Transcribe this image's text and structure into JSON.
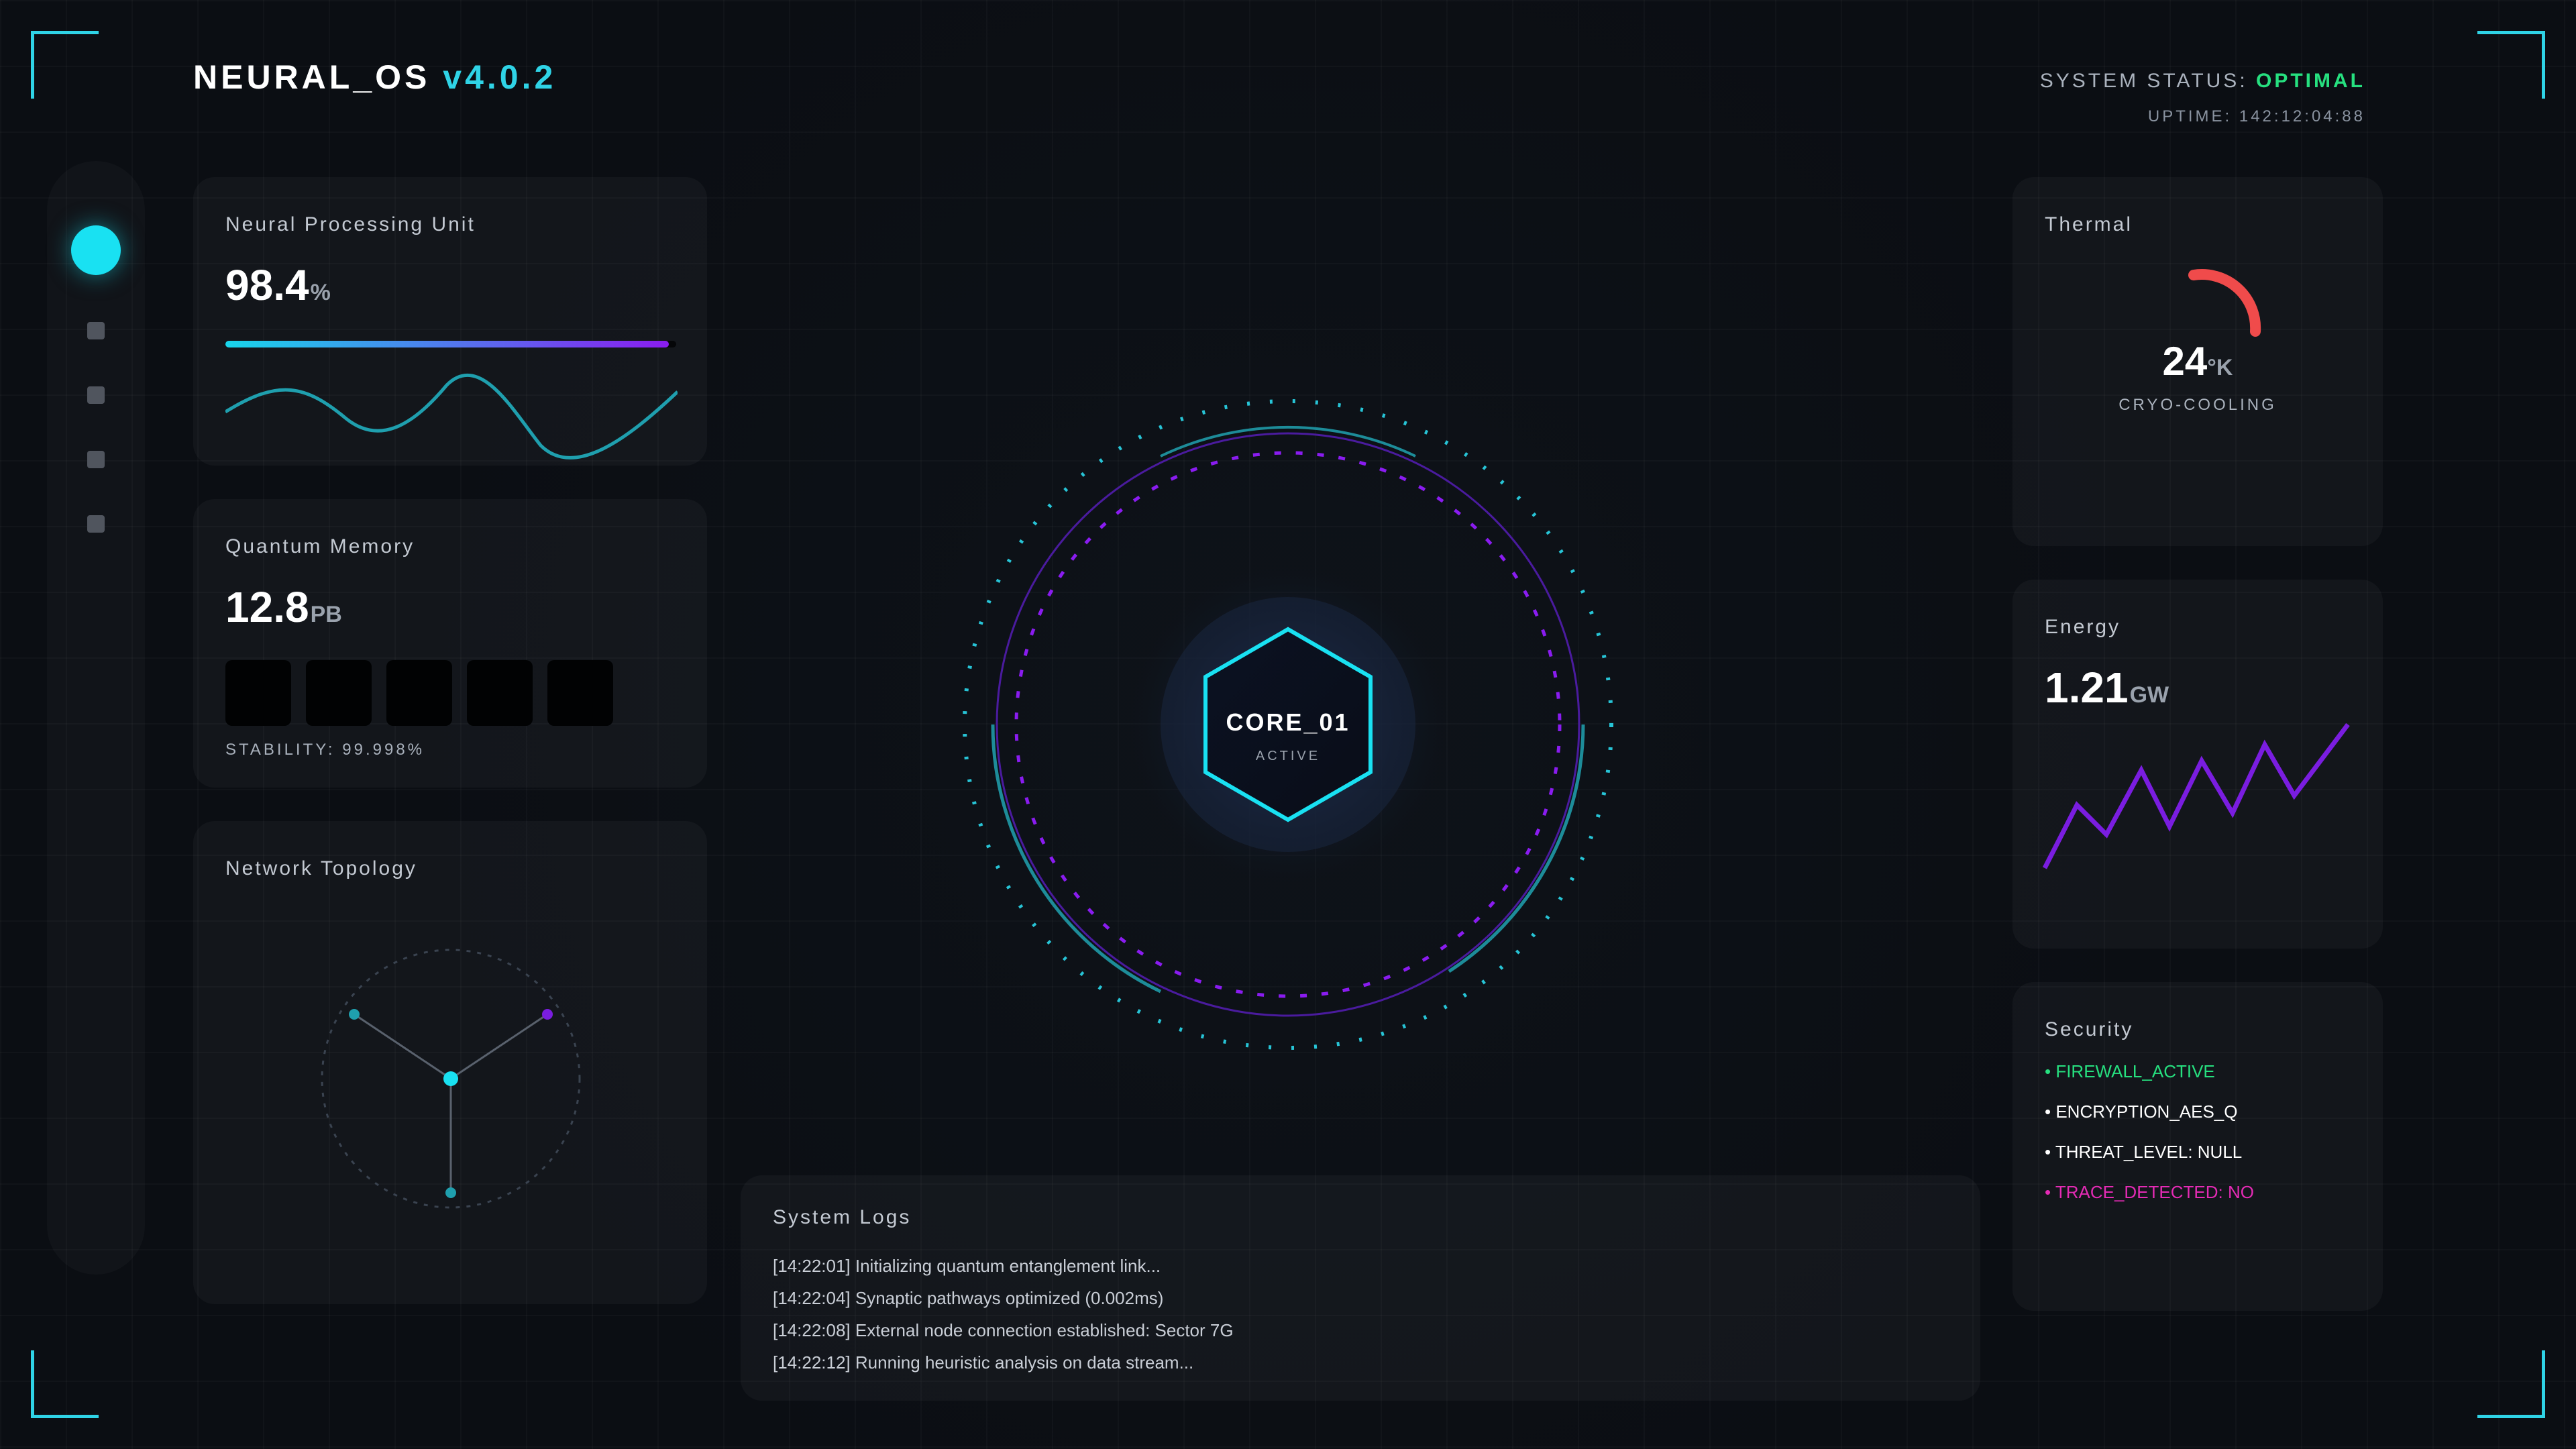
{
  "header": {
    "brand_name": "NEURAL_OS",
    "version": "v4.0.2",
    "status_label": "SYSTEM STATUS:",
    "status_value": "OPTIMAL",
    "uptime": "UPTIME: 142:12:04:88"
  },
  "colors": {
    "accent": "#2fd3e6",
    "status_ok": "#26e07f",
    "purple": "#8a1cf0",
    "alert": "#e42bb5",
    "thermal": "#f04b4b"
  },
  "sidebar": {
    "items": [
      {
        "icon": "active-dot-icon",
        "active": true
      },
      {
        "icon": "square-icon",
        "active": false
      },
      {
        "icon": "square-icon",
        "active": false
      },
      {
        "icon": "square-icon",
        "active": false
      },
      {
        "icon": "square-icon",
        "active": false
      }
    ]
  },
  "npu": {
    "title": "Neural Processing Unit",
    "value": "98.4",
    "unit": "%",
    "progress": 0.984
  },
  "memory": {
    "title": "Quantum Memory",
    "value": "12.8",
    "unit": "PB",
    "blocks": 5,
    "stability": "STABILITY: 99.998%"
  },
  "network": {
    "title": "Network Topology"
  },
  "core": {
    "name": "CORE_01",
    "state": "ACTIVE"
  },
  "logs": {
    "title": "System Logs",
    "lines": [
      "[14:22:01] Initializing quantum entanglement link...",
      "[14:22:04] Synaptic pathways optimized (0.002ms)",
      "[14:22:08] External node connection established: Sector 7G",
      "[14:22:12] Running heuristic analysis on data stream..."
    ]
  },
  "thermal": {
    "title": "Thermal",
    "value": "24",
    "unit": "°K",
    "label": "CRYO-COOLING"
  },
  "energy": {
    "title": "Energy",
    "value": "1.21",
    "unit": "GW"
  },
  "security": {
    "title": "Security",
    "items": [
      {
        "text": "• FIREWALL_ACTIVE",
        "color": "#26e07f"
      },
      {
        "text": "• ENCRYPTION_AES_Q",
        "color": "#ffffff"
      },
      {
        "text": "• THREAT_LEVEL: NULL",
        "color": "#ffffff"
      },
      {
        "text": "• TRACE_DETECTED: NO",
        "color": "#e42bb5"
      }
    ]
  }
}
